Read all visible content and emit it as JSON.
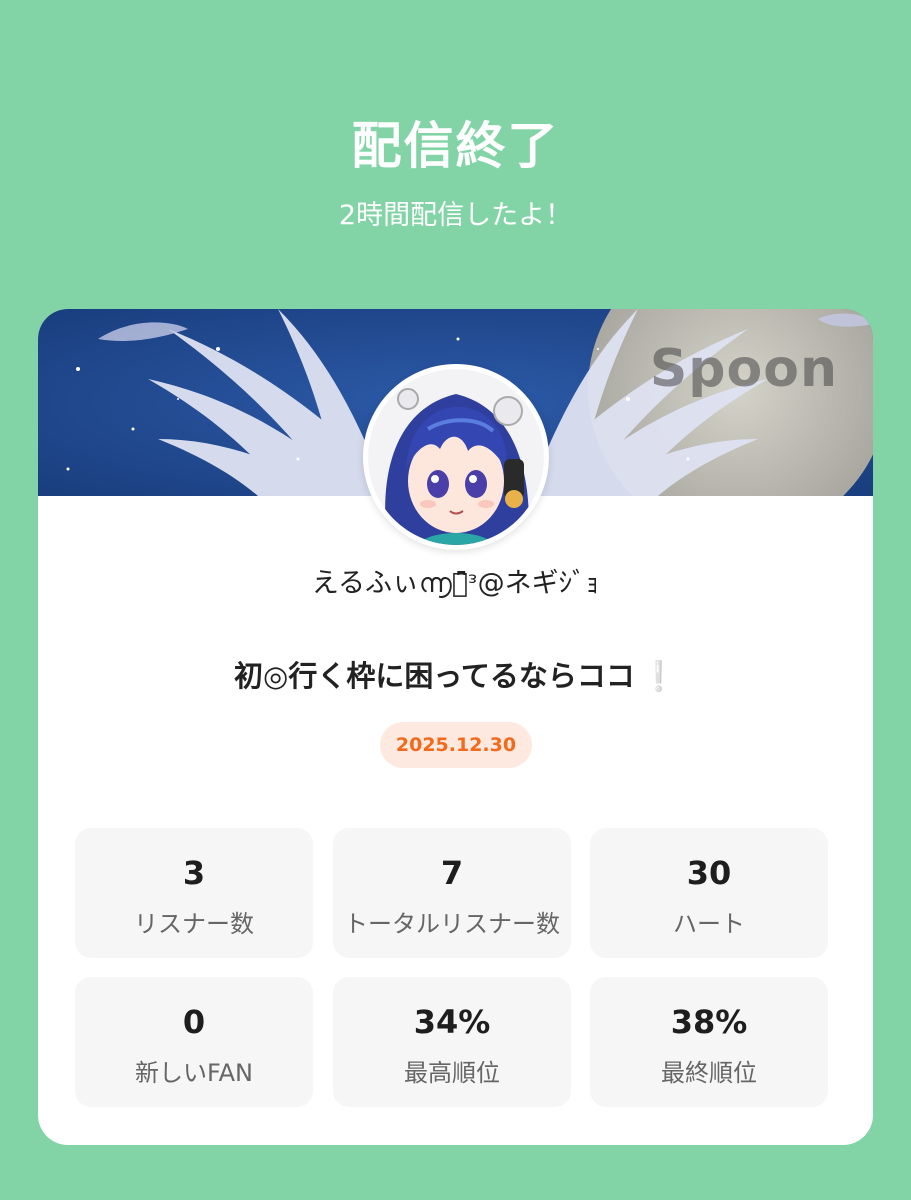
{
  "header": {
    "title": "配信終了",
    "subtitle": "2時間配信したよ！"
  },
  "banner": {
    "logo_text": "Spoon"
  },
  "profile": {
    "name": "えるふぃ൬ꀀ͆ᵌ@ネギｼﾞｮ"
  },
  "broadcast": {
    "title": "初◎行く枠に困ってるならココ",
    "title_suffix": "❕",
    "date": "2025.12.30"
  },
  "stats": [
    {
      "value": "3",
      "label": "リスナー数"
    },
    {
      "value": "7",
      "label": "トータルリスナー数"
    },
    {
      "value": "30",
      "label": "ハート"
    },
    {
      "value": "0",
      "label": "新しいFAN"
    },
    {
      "value": "34%",
      "label": "最高順位"
    },
    {
      "value": "38%",
      "label": "最終順位"
    }
  ],
  "colors": {
    "background": "#82d4a6",
    "card": "#ffffff",
    "date_badge_bg": "#fde9e0",
    "date_badge_text": "#f26a1b",
    "stat_bg": "#f6f6f6"
  }
}
